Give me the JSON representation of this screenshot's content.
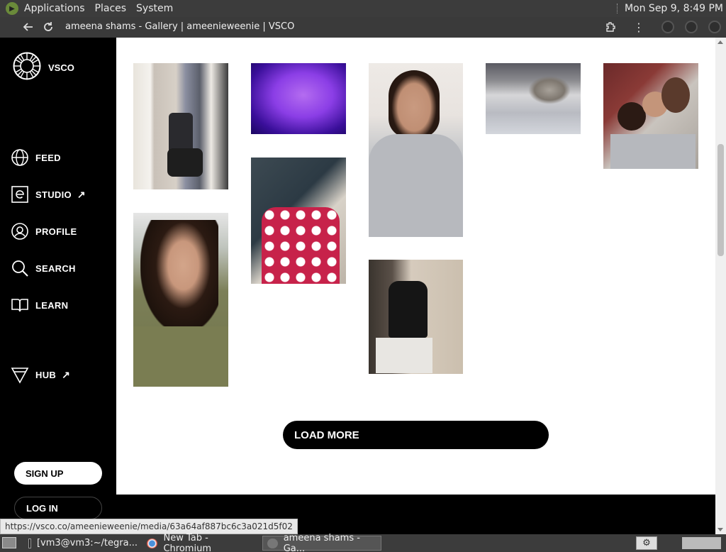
{
  "top_panel": {
    "menus": [
      "Applications",
      "Places",
      "System"
    ],
    "clock": "Mon Sep  9,  8:49 PM"
  },
  "browser": {
    "title": "ameena shams - Gallery | ameenieweenie | VSCO",
    "status_url": "https://vsco.co/ameenieweenie/media/63a64af887bc6c3a021d5f02"
  },
  "sidebar": {
    "brand": "VSCO",
    "nav": [
      {
        "label": "FEED",
        "icon": "globe-icon"
      },
      {
        "label": "STUDIO",
        "icon": "studio-icon",
        "external": true
      },
      {
        "label": "PROFILE",
        "icon": "profile-icon"
      },
      {
        "label": "SEARCH",
        "icon": "search-icon"
      },
      {
        "label": "LEARN",
        "icon": "book-icon"
      },
      {
        "label": "HUB",
        "icon": "hub-icon",
        "external": true
      }
    ],
    "signup_label": "SIGN UP",
    "login_label": "LOG IN"
  },
  "gallery": {
    "load_more_label": "LOAD MORE"
  },
  "taskbar": {
    "tasks": [
      {
        "label": "[vm3@vm3:~/tegra..."
      },
      {
        "label": "New Tab - Chromium"
      },
      {
        "label": "ameena shams - Ga..."
      }
    ]
  },
  "colors": {
    "accent": "#000000",
    "panel": "#3c3c3c",
    "content_bg": "#ffffff"
  }
}
